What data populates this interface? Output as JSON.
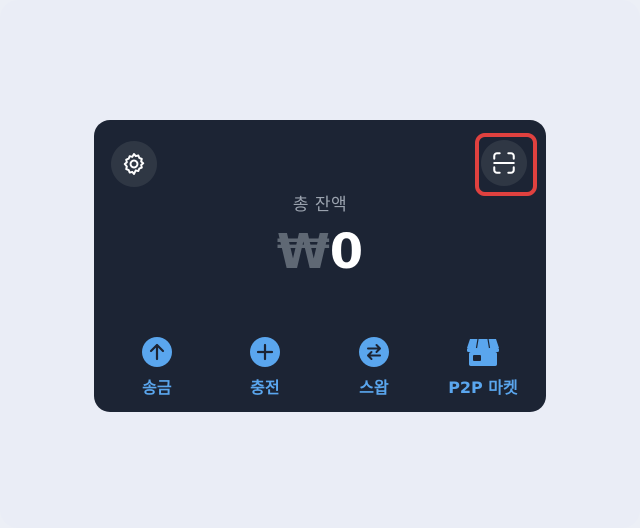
{
  "wallet": {
    "balance_label": "총 잔액",
    "currency_symbol": "₩",
    "balance_value": "0",
    "settings_icon": "gear-icon",
    "scan_icon": "qr-scan-icon"
  },
  "actions": [
    {
      "label": "송금",
      "icon": "arrow-up-icon"
    },
    {
      "label": "충전",
      "icon": "plus-icon"
    },
    {
      "label": "스왑",
      "icon": "swap-arrows-icon"
    },
    {
      "label": "P2P 마켓",
      "icon": "storefront-icon"
    }
  ],
  "colors": {
    "card_background": "#1c2434",
    "accent": "#5aa6ee",
    "highlight": "#e0413f"
  }
}
